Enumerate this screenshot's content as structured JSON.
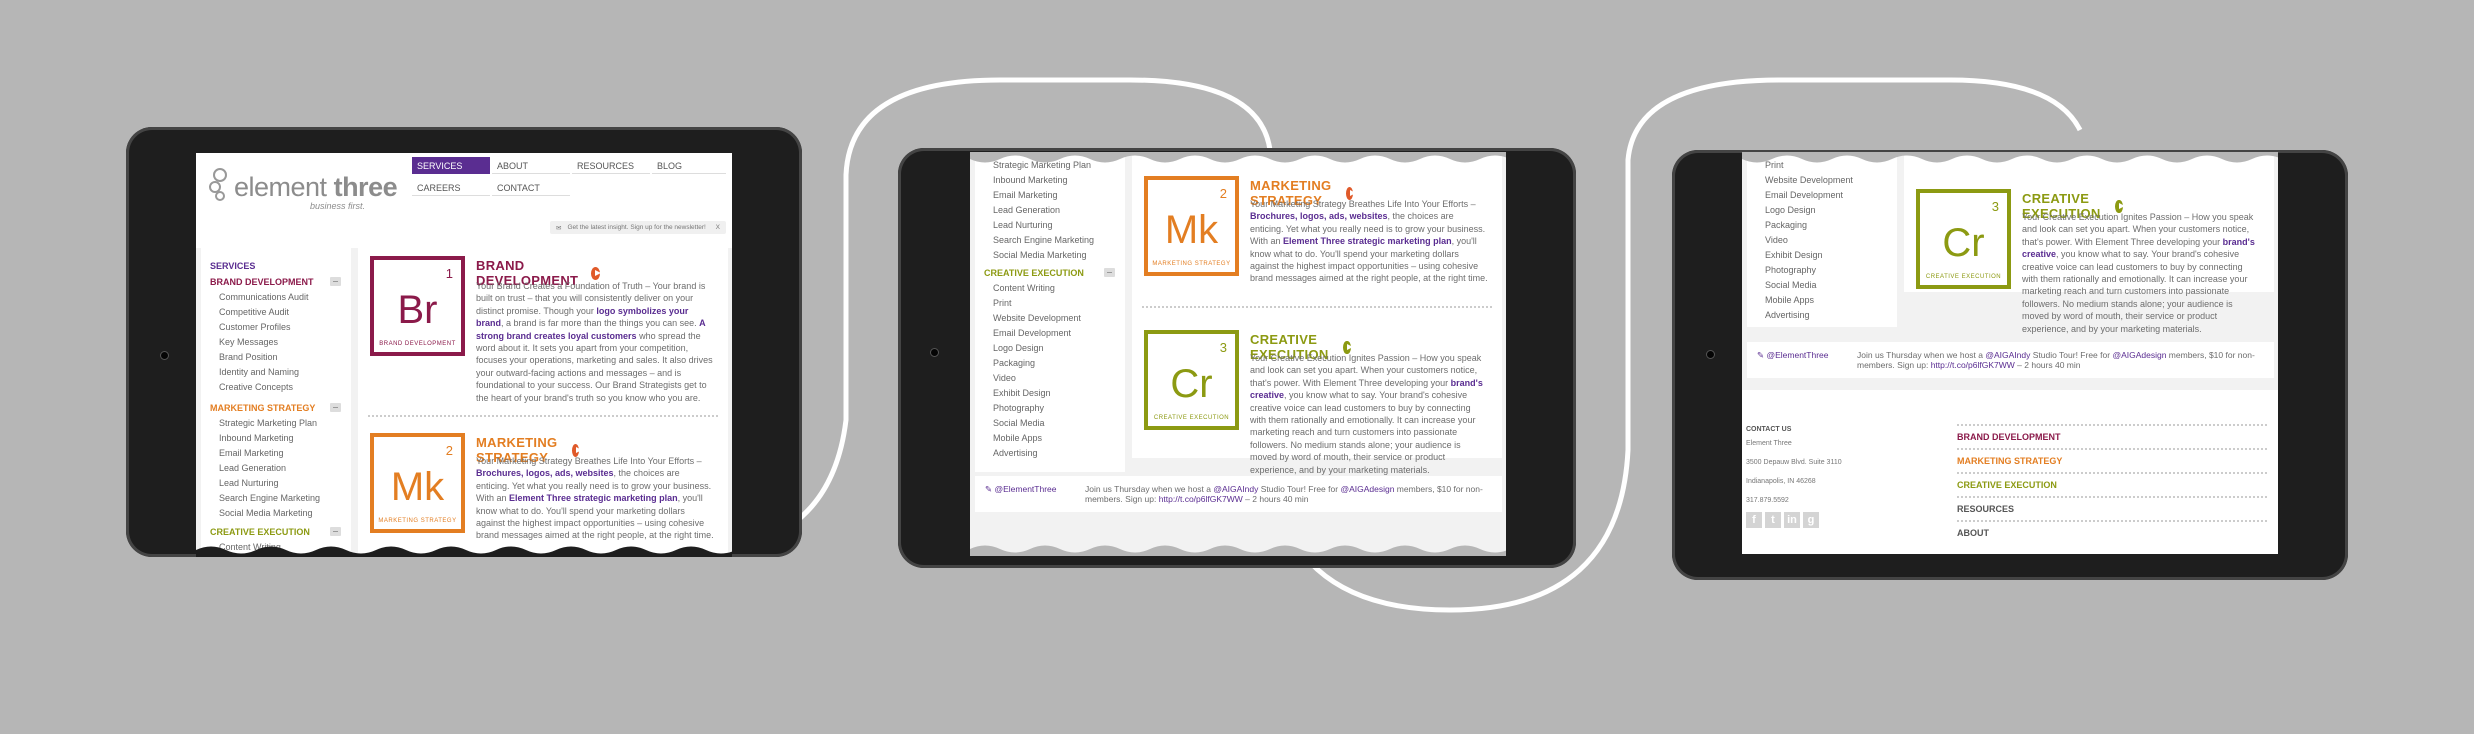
{
  "colors": {
    "purple": "#5a2d91",
    "brand": "#8b1a4a",
    "marketing": "#e37e22",
    "creative": "#8c9a12",
    "bezel": "#1e1e1e",
    "background": "#b6b6b6"
  },
  "header": {
    "logo_main": "element",
    "logo_bold": "three",
    "tagline": "business first.",
    "nav": {
      "services": "SERVICES",
      "about": "ABOUT",
      "resources": "RESOURCES",
      "blog": "BLOG",
      "careers": "CAREERS",
      "contact": "CONTACT"
    },
    "newsletter": "Get the latest insight. Sign up for the newsletter!",
    "newsletter_close": "X"
  },
  "sidebar": {
    "heading": "SERVICES",
    "brand_development": {
      "label": "BRAND DEVELOPMENT",
      "items": [
        "Communications Audit",
        "Competitive Audit",
        "Customer Profiles",
        "Key Messages",
        "Brand Position",
        "Identity and Naming",
        "Creative Concepts"
      ]
    },
    "marketing_strategy": {
      "label": "MARKETING STRATEGY",
      "items": [
        "Strategic Marketing Plan",
        "Inbound Marketing",
        "Email Marketing",
        "Lead Generation",
        "Lead Nurturing",
        "Search Engine Marketing",
        "Social Media Marketing"
      ]
    },
    "creative_execution": {
      "label": "CREATIVE EXECUTION",
      "items": [
        "Content Writing",
        "Print",
        "Website Development",
        "Email Development",
        "Logo Design",
        "Packaging",
        "Video",
        "Exhibit Design",
        "Photography",
        "Social Media",
        "Mobile Apps",
        "Advertising"
      ]
    }
  },
  "cards": {
    "brand": {
      "symbol": "Br",
      "number": "1",
      "tile_label": "BRAND DEVELOPMENT",
      "title": "BRAND DEVELOPMENT",
      "p1": "Your Brand Creates a Foundation of Truth – Your brand is built on trust – that you will consistently deliver on your distinct promise. Though your ",
      "b1": "logo symbolizes your brand",
      "p2": ", a brand is far more than the things you can see. ",
      "b2": "A strong brand creates loyal customers",
      "p3": " who spread the word about it. It sets you apart from your competition, focuses your operations, marketing and sales. It also drives your outward-facing actions and messages – and is foundational to your success. Our Brand Strategists get to the heart of your brand's truth so you know who you are."
    },
    "marketing": {
      "symbol": "Mk",
      "number": "2",
      "tile_label": "MARKETING STRATEGY",
      "title": "MARKETING STRATEGY",
      "p1": "Your Marketing Strategy Breathes Life Into Your Efforts – ",
      "b1": "Brochures, logos, ads, websites",
      "p2": ", the choices are enticing. Yet what you really need is to grow your business. With an ",
      "b2": "Element Three strategic marketing plan",
      "p3": ", you'll know what to do. You'll spend your marketing dollars against the highest impact opportunities – using cohesive brand messages aimed at the right people, at the right time."
    },
    "creative": {
      "symbol": "Cr",
      "number": "3",
      "tile_label": "CREATIVE EXECUTION",
      "title": "CREATIVE EXECUTION",
      "p1": "Your Creative Execution Ignites Passion – How you speak and look can set you apart. When your customers notice, that's power. With Element Three developing your ",
      "b1": "brand's creative",
      "p2": ", you know what to say. Your brand's cohesive creative voice can lead customers to buy by connecting with them rationally and emotionally. It can increase your marketing reach and turn customers into passionate followers. No medium stands alone; your audience is moved by word of mouth, their service or product experience, and by your marketing materials."
    }
  },
  "tweet": {
    "handle": "@ElementThree",
    "text1": "Join us Thursday when we host a ",
    "m1": "@AIGAIndy",
    "text2": " Studio Tour! Free for ",
    "m2": "@AIGAdesign",
    "text3": " members, $10 for non-members. Sign up: ",
    "link": "http://t.co/p6lfGK7WW",
    "time": " – 2 hours 40 min"
  },
  "footer": {
    "contact_label": "CONTACT US",
    "company": "Element Three",
    "address": "3500 Depauw Blvd. Suite 3110",
    "city": "Indianapolis, IN 46268",
    "phone": "317.879.5592",
    "nav": [
      "BRAND DEVELOPMENT",
      "MARKETING STRATEGY",
      "CREATIVE EXECUTION",
      "RESOURCES",
      "ABOUT"
    ]
  }
}
